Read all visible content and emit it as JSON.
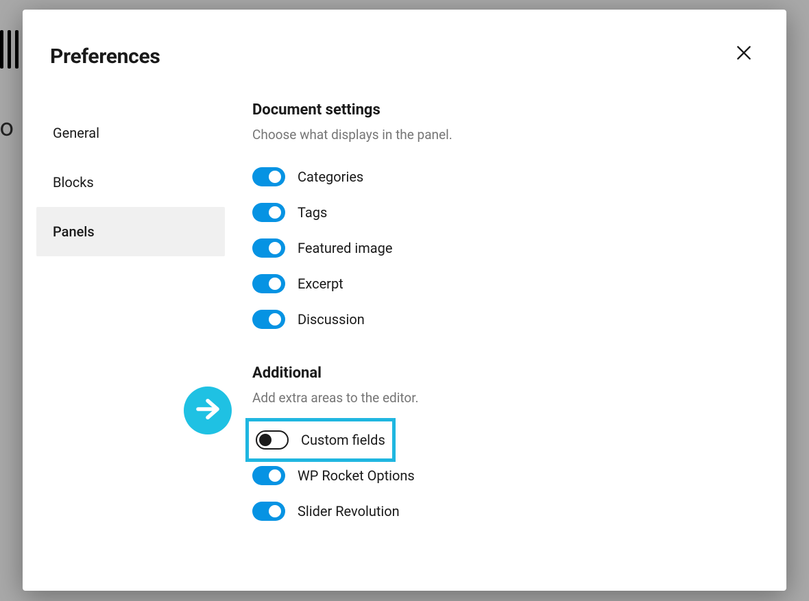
{
  "background": {
    "partial_text": "e to"
  },
  "modal": {
    "title": "Preferences",
    "tabs": [
      {
        "label": "General",
        "active": false
      },
      {
        "label": "Blocks",
        "active": false
      },
      {
        "label": "Panels",
        "active": true
      }
    ],
    "sections": [
      {
        "title": "Document settings",
        "description": "Choose what displays in the panel.",
        "toggles": [
          {
            "label": "Categories",
            "on": true,
            "highlighted": false
          },
          {
            "label": "Tags",
            "on": true,
            "highlighted": false
          },
          {
            "label": "Featured image",
            "on": true,
            "highlighted": false
          },
          {
            "label": "Excerpt",
            "on": true,
            "highlighted": false
          },
          {
            "label": "Discussion",
            "on": true,
            "highlighted": false
          }
        ]
      },
      {
        "title": "Additional",
        "description": "Add extra areas to the editor.",
        "toggles": [
          {
            "label": "Custom fields",
            "on": false,
            "highlighted": true
          },
          {
            "label": "WP Rocket Options",
            "on": true,
            "highlighted": false
          },
          {
            "label": "Slider Revolution",
            "on": true,
            "highlighted": false
          }
        ]
      }
    ]
  }
}
